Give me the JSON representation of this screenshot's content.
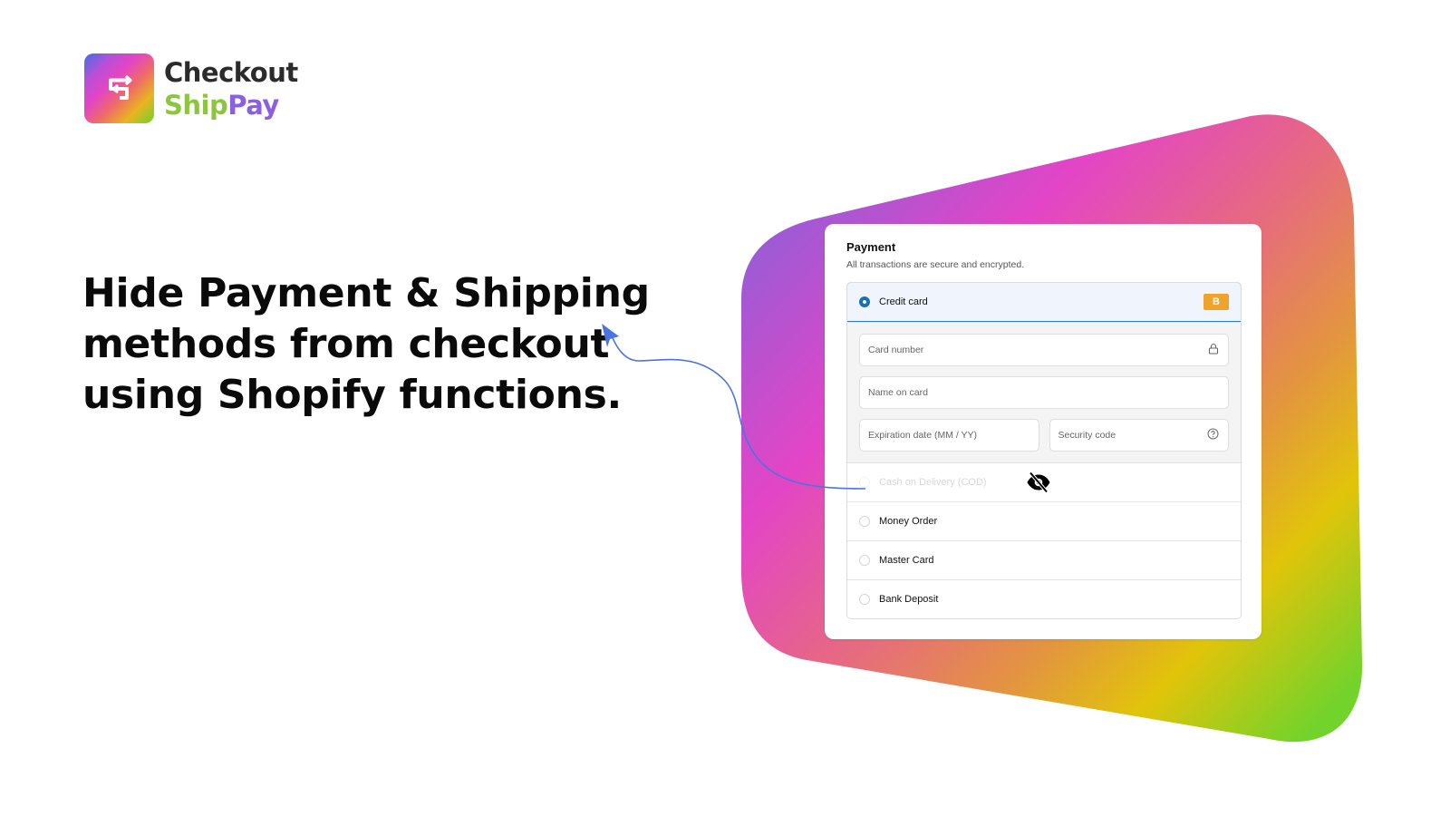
{
  "brand": {
    "name_line1": "Checkout",
    "name_ship": "Ship",
    "name_pay": "Pay",
    "colors": {
      "ship": "#8cc63f",
      "pay": "#8a5fe0",
      "dark": "#2b2b2b"
    },
    "icon": "swap-arrows-icon"
  },
  "headline": {
    "lines": [
      "Hide Payment & Shipping",
      "methods from checkout",
      "using Shopify functions."
    ]
  },
  "payment": {
    "title": "Payment",
    "subtitle": "All transactions are secure and encrypted.",
    "methods": [
      {
        "label": "Credit card",
        "selected": true,
        "badge": "B"
      },
      {
        "label": "Cash on Delivery (COD)",
        "selected": false,
        "hidden": true,
        "icon": "eye-off-icon"
      },
      {
        "label": "Money Order",
        "selected": false
      },
      {
        "label": "Master Card",
        "selected": false
      },
      {
        "label": "Bank Deposit",
        "selected": false
      }
    ],
    "fields": {
      "card_number": {
        "placeholder": "Card number",
        "icon": "lock-icon"
      },
      "name_on_card": {
        "placeholder": "Name on card"
      },
      "expiration": {
        "placeholder": "Expiration date (MM / YY)"
      },
      "security_code": {
        "placeholder": "Security code",
        "icon": "help-circle-icon"
      }
    }
  },
  "colors": {
    "accent_blue": "#1a6fb3",
    "badge_orange": "#f0a32a",
    "arrow_blue": "#4a74e0"
  }
}
